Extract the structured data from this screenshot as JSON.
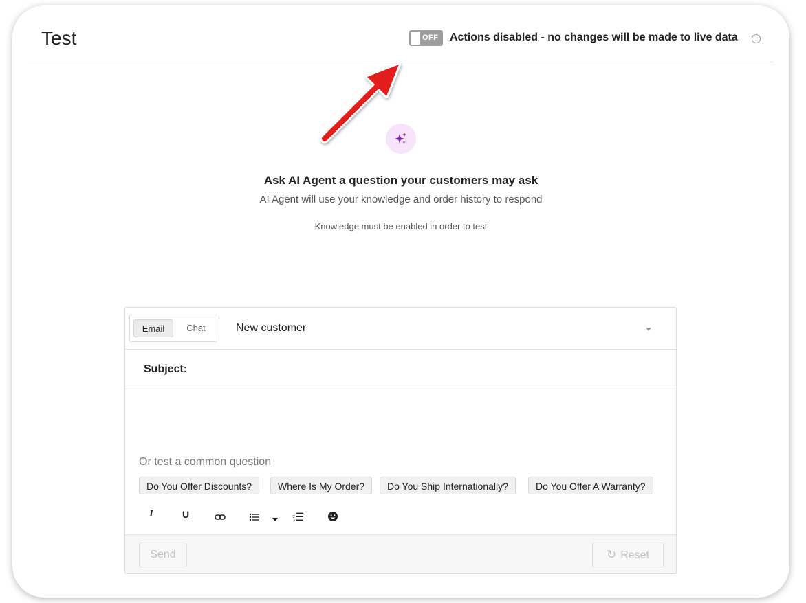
{
  "header": {
    "title": "Test",
    "toggle_state": "OFF",
    "actions_notice": "Actions disabled - no changes will be made to live data",
    "info_icon": "i"
  },
  "hero": {
    "icon": "sparkle-icon",
    "title": "Ask AI Agent a question your customers may ask",
    "subtitle": "AI Agent will use your knowledge and order history to respond",
    "note": "Knowledge must be enabled in order to test"
  },
  "composer": {
    "channel_tabs": [
      {
        "label": "Email",
        "selected": true
      },
      {
        "label": "Chat",
        "selected": false
      }
    ],
    "customer_selected": "New customer",
    "subject_label": "Subject:",
    "common_label": "Or test a common question",
    "common_questions": [
      "Do You Offer Discounts?",
      "Where Is My Order?",
      "Do You Ship Internationally?",
      "Do You Offer A Warranty?"
    ],
    "toolbar": {
      "italic": "I",
      "underline": "U"
    },
    "send_label": "Send",
    "reset_label": "Reset"
  },
  "colors": {
    "toggle_off": "#9e9e9e",
    "annotation_arrow": "#e31b1b",
    "sparkle_bg": "#f7e4fb",
    "sparkle": "#7a1fa2"
  }
}
